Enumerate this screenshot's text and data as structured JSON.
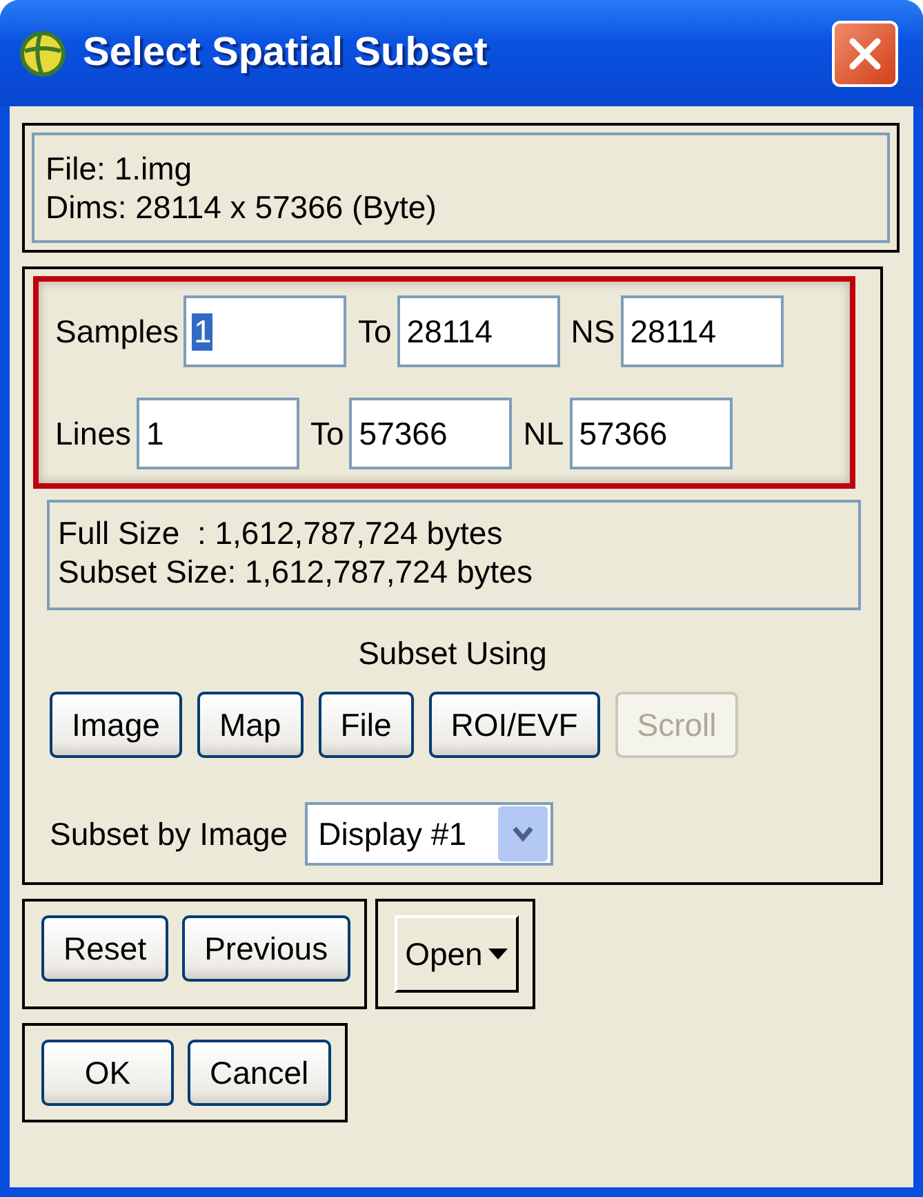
{
  "window": {
    "title": "Select Spatial Subset"
  },
  "file_info": [
    "File: 1.img",
    "Dims: 28114 x 57366 (Byte)"
  ],
  "ranges": [
    {
      "fields": [
        {
          "label": "Samples",
          "value": "1",
          "selected": true
        },
        {
          "label": "To",
          "value": "28114",
          "selected": false
        },
        {
          "label": "NS",
          "value": "28114",
          "selected": false
        }
      ]
    },
    {
      "fields": [
        {
          "label": "Lines",
          "value": "1",
          "selected": false
        },
        {
          "label": "To",
          "value": "57366",
          "selected": false
        },
        {
          "label": "NL",
          "value": "57366",
          "selected": false
        }
      ]
    }
  ],
  "sizes": [
    "Full Size  : 1,612,787,724 bytes",
    "Subset Size: 1,612,787,724 bytes"
  ],
  "subset_using": {
    "heading": "Subset Using",
    "buttons": [
      {
        "label": "Image",
        "disabled": false
      },
      {
        "label": "Map",
        "disabled": false
      },
      {
        "label": "File",
        "disabled": false
      },
      {
        "label": "ROI/EVF",
        "disabled": false
      },
      {
        "label": "Scroll",
        "disabled": true
      }
    ]
  },
  "subset_by": {
    "label": "Subset by Image",
    "value": "Display #1"
  },
  "action_buttons": [
    "Reset",
    "Previous"
  ],
  "open_menu": {
    "label": "Open"
  },
  "dialog_buttons": [
    "OK",
    "Cancel"
  ]
}
